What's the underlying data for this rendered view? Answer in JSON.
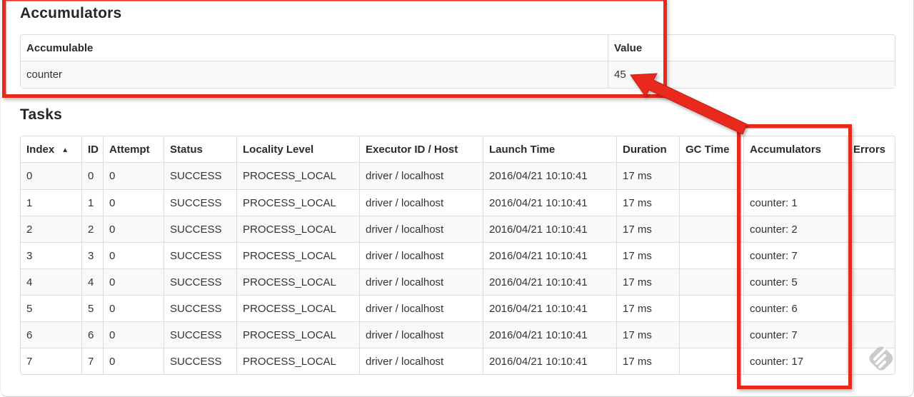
{
  "accumulators": {
    "title": "Accumulators",
    "headers": [
      "Accumulable",
      "Value"
    ],
    "rows": [
      [
        "counter",
        "45"
      ]
    ]
  },
  "tasks": {
    "title": "Tasks",
    "headers": [
      "Index",
      "ID",
      "Attempt",
      "Status",
      "Locality Level",
      "Executor ID / Host",
      "Launch Time",
      "Duration",
      "GC Time",
      "Accumulators",
      "Errors"
    ],
    "sort": {
      "column": "Index",
      "indicator": "▲"
    },
    "rows": [
      [
        "0",
        "0",
        "0",
        "SUCCESS",
        "PROCESS_LOCAL",
        "driver / localhost",
        "2016/04/21 10:10:41",
        "17 ms",
        "",
        "",
        ""
      ],
      [
        "1",
        "1",
        "0",
        "SUCCESS",
        "PROCESS_LOCAL",
        "driver / localhost",
        "2016/04/21 10:10:41",
        "17 ms",
        "",
        "counter: 1",
        ""
      ],
      [
        "2",
        "2",
        "0",
        "SUCCESS",
        "PROCESS_LOCAL",
        "driver / localhost",
        "2016/04/21 10:10:41",
        "17 ms",
        "",
        "counter: 2",
        ""
      ],
      [
        "3",
        "3",
        "0",
        "SUCCESS",
        "PROCESS_LOCAL",
        "driver / localhost",
        "2016/04/21 10:10:41",
        "17 ms",
        "",
        "counter: 7",
        ""
      ],
      [
        "4",
        "4",
        "0",
        "SUCCESS",
        "PROCESS_LOCAL",
        "driver / localhost",
        "2016/04/21 10:10:41",
        "17 ms",
        "",
        "counter: 5",
        ""
      ],
      [
        "5",
        "5",
        "0",
        "SUCCESS",
        "PROCESS_LOCAL",
        "driver / localhost",
        "2016/04/21 10:10:41",
        "17 ms",
        "",
        "counter: 6",
        ""
      ],
      [
        "6",
        "6",
        "0",
        "SUCCESS",
        "PROCESS_LOCAL",
        "driver / localhost",
        "2016/04/21 10:10:41",
        "17 ms",
        "",
        "counter: 7",
        ""
      ],
      [
        "7",
        "7",
        "0",
        "SUCCESS",
        "PROCESS_LOCAL",
        "driver / localhost",
        "2016/04/21 10:10:41",
        "17 ms",
        "",
        "counter: 17",
        ""
      ]
    ]
  },
  "annotations": {
    "red_color": "#e8291c",
    "box1_target": "Accumulators section",
    "box2_target": "Accumulators column",
    "arrow_points_to": "45"
  }
}
